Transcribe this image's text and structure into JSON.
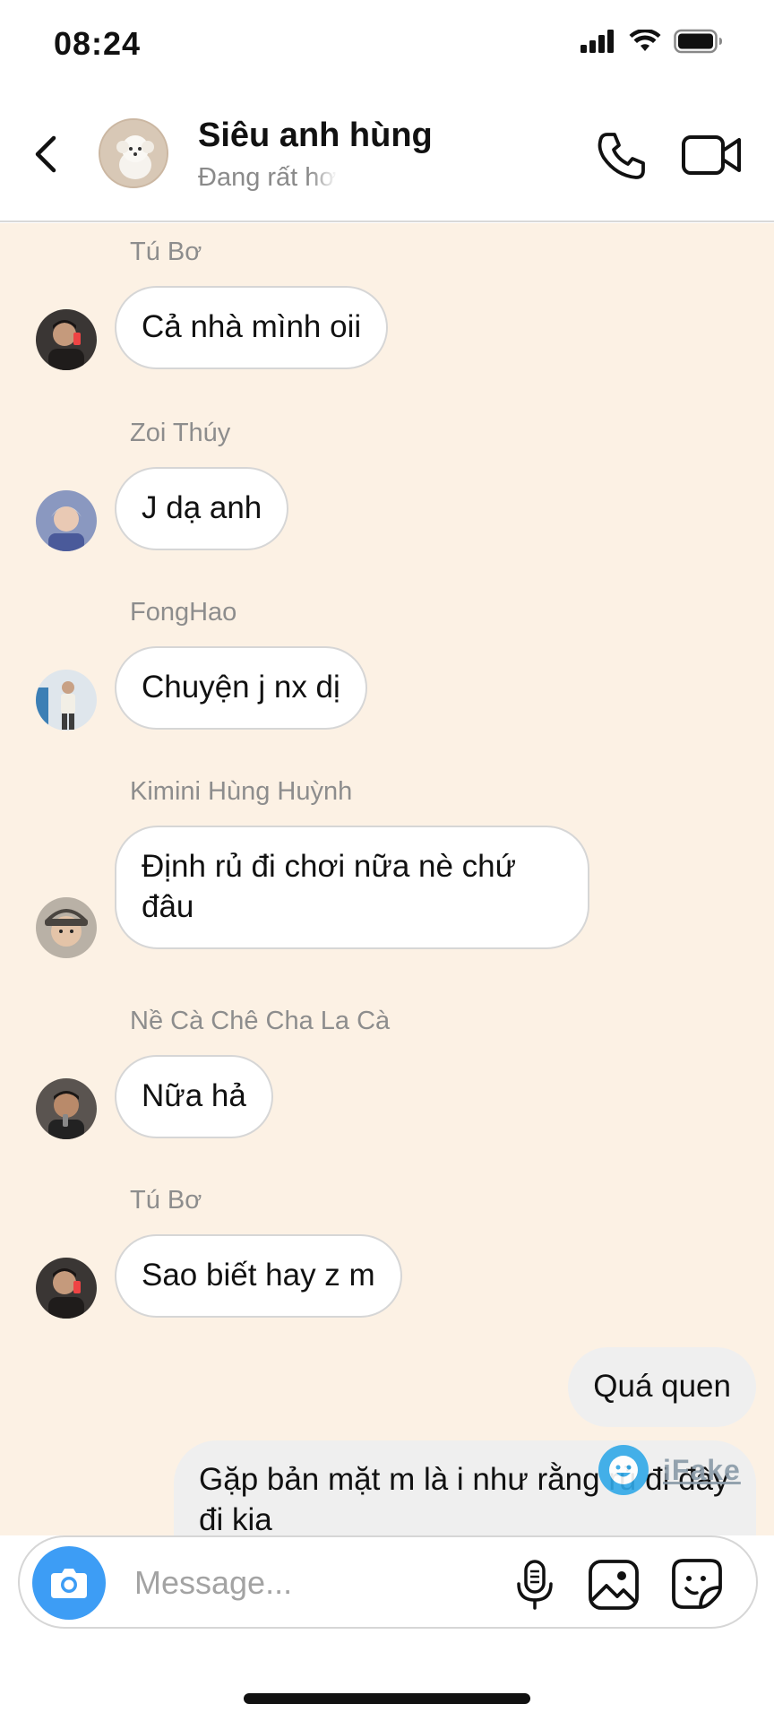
{
  "status_bar": {
    "time": "08:24",
    "icons": [
      "signal-icon",
      "wifi-icon",
      "battery-icon"
    ]
  },
  "header": {
    "title": "Siêu anh hùng",
    "subtitle": "Đang rất hơ",
    "icons": [
      "back-icon",
      "phone-icon",
      "video-camera-icon"
    ]
  },
  "messages": [
    {
      "sender": "Tú Bơ",
      "text": "Cả nhà mình oii"
    },
    {
      "sender": "Zoi Thúy",
      "text": "J dạ anh"
    },
    {
      "sender": "FongHao",
      "text": "Chuyện j nx dị"
    },
    {
      "sender": "Kimini Hùng Huỳnh",
      "text": "Định rủ đi chơi nữa nè chứ đâu"
    },
    {
      "sender": "Nề Cà Chê Cha La Cà",
      "text": "Nữa hả"
    },
    {
      "sender": "Tú Bơ",
      "text": "Sao biết hay z m"
    }
  ],
  "outgoing": [
    {
      "text": "Quá quen"
    },
    {
      "text": "Gặp bản mặt m là i như rằng rủ đi đây đi kia"
    }
  ],
  "watermark": {
    "text": "iFake"
  },
  "composer": {
    "placeholder": "Message...",
    "icons": [
      "camera-icon",
      "microphone-icon",
      "gallery-icon",
      "sticker-icon"
    ]
  },
  "colors": {
    "chat_background": "#fcf1e4",
    "incoming_bubble": "#ffffff",
    "outgoing_bubble": "#efefef",
    "camera_button": "#3d9df5"
  }
}
